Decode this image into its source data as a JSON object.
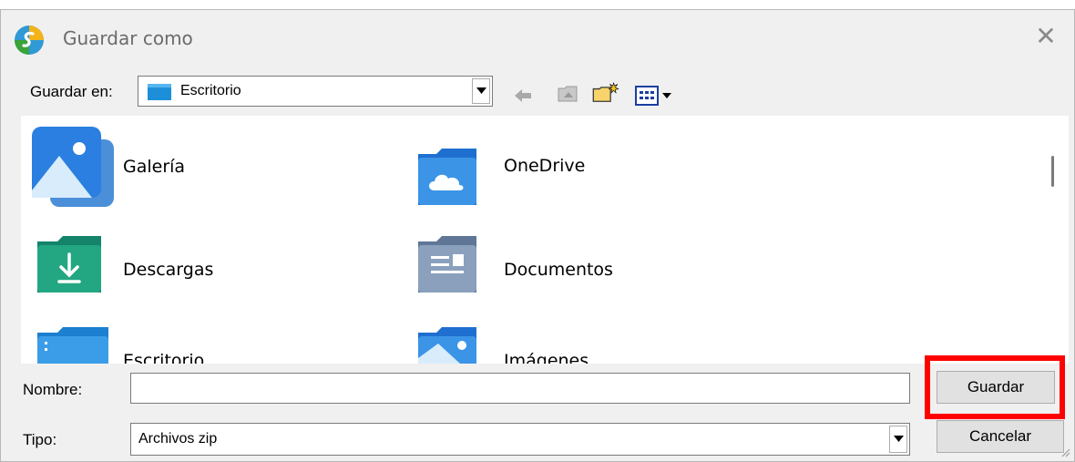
{
  "window": {
    "title": "Guardar como",
    "app_icon": "app-logo-icon",
    "close_icon": "close-icon"
  },
  "toolbar": {
    "save_in_label": "Guardar en:",
    "location_value": "Escritorio",
    "location_icon": "desktop-folder-icon",
    "back_icon": "back-arrow-icon",
    "up_icon": "up-folder-icon",
    "new_folder_icon": "new-folder-icon",
    "view_menu_icon": "view-menu-icon"
  },
  "files": [
    {
      "label": "Galería",
      "icon": "gallery-icon"
    },
    {
      "label": "OneDrive",
      "icon": "onedrive-folder-icon"
    },
    {
      "label": "Descargas",
      "icon": "downloads-folder-icon"
    },
    {
      "label": "Documentos",
      "icon": "documents-folder-icon"
    },
    {
      "label": "Escritorio",
      "icon": "desktop-folder-icon"
    },
    {
      "label": "Imágenes",
      "icon": "pictures-folder-icon"
    }
  ],
  "form": {
    "name_label": "Nombre:",
    "name_value": "",
    "type_label": "Tipo:",
    "type_value": "Archivos zip",
    "save_button": "Guardar",
    "cancel_button": "Cancelar"
  },
  "colors": {
    "highlight": "#ff0000",
    "dialog_bg": "#f0f0f0",
    "folder_blue": "#2b8ae0",
    "folder_green": "#1e9e7a",
    "folder_gray": "#7d93b3"
  }
}
